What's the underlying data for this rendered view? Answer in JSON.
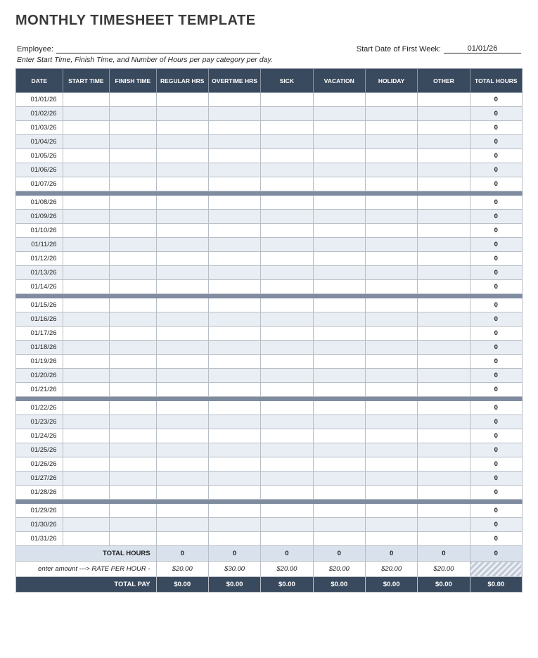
{
  "title": "MONTHLY TIMESHEET TEMPLATE",
  "employee_label": "Employee:",
  "employee_value": "",
  "start_date_label": "Start Date of First Week:",
  "start_date_value": "01/01/26",
  "hint": "Enter Start Time, Finish Time, and Number of Hours per pay category per day.",
  "headers": [
    "DATE",
    "START TIME",
    "FINISH TIME",
    "REGULAR HRS",
    "OVERTIME HRS",
    "SICK",
    "VACATION",
    "HOLIDAY",
    "OTHER",
    "TOTAL HOURS"
  ],
  "weeks": [
    [
      {
        "date": "01/01/26",
        "total": "0"
      },
      {
        "date": "01/02/26",
        "total": "0"
      },
      {
        "date": "01/03/26",
        "total": "0"
      },
      {
        "date": "01/04/26",
        "total": "0"
      },
      {
        "date": "01/05/26",
        "total": "0"
      },
      {
        "date": "01/06/26",
        "total": "0"
      },
      {
        "date": "01/07/26",
        "total": "0"
      }
    ],
    [
      {
        "date": "01/08/26",
        "total": "0"
      },
      {
        "date": "01/09/26",
        "total": "0"
      },
      {
        "date": "01/10/26",
        "total": "0"
      },
      {
        "date": "01/11/26",
        "total": "0"
      },
      {
        "date": "01/12/26",
        "total": "0"
      },
      {
        "date": "01/13/26",
        "total": "0"
      },
      {
        "date": "01/14/26",
        "total": "0"
      }
    ],
    [
      {
        "date": "01/15/26",
        "total": "0"
      },
      {
        "date": "01/16/26",
        "total": "0"
      },
      {
        "date": "01/17/26",
        "total": "0"
      },
      {
        "date": "01/18/26",
        "total": "0"
      },
      {
        "date": "01/19/26",
        "total": "0"
      },
      {
        "date": "01/20/26",
        "total": "0"
      },
      {
        "date": "01/21/26",
        "total": "0"
      }
    ],
    [
      {
        "date": "01/22/26",
        "total": "0"
      },
      {
        "date": "01/23/26",
        "total": "0"
      },
      {
        "date": "01/24/26",
        "total": "0"
      },
      {
        "date": "01/25/26",
        "total": "0"
      },
      {
        "date": "01/26/26",
        "total": "0"
      },
      {
        "date": "01/27/26",
        "total": "0"
      },
      {
        "date": "01/28/26",
        "total": "0"
      }
    ],
    [
      {
        "date": "01/29/26",
        "total": "0"
      },
      {
        "date": "01/30/26",
        "total": "0"
      },
      {
        "date": "01/31/26",
        "total": "0"
      }
    ]
  ],
  "totals": {
    "label": "TOTAL HOURS",
    "regular": "0",
    "overtime": "0",
    "sick": "0",
    "vacation": "0",
    "holiday": "0",
    "other": "0",
    "grand": "0"
  },
  "rate": {
    "label": "enter amount ---> RATE PER HOUR -",
    "regular": "$20.00",
    "overtime": "$30.00",
    "sick": "$20.00",
    "vacation": "$20.00",
    "holiday": "$20.00",
    "other": "$20.00"
  },
  "pay": {
    "label": "TOTAL PAY",
    "regular": "$0.00",
    "overtime": "$0.00",
    "sick": "$0.00",
    "vacation": "$0.00",
    "holiday": "$0.00",
    "other": "$0.00",
    "grand": "$0.00"
  }
}
